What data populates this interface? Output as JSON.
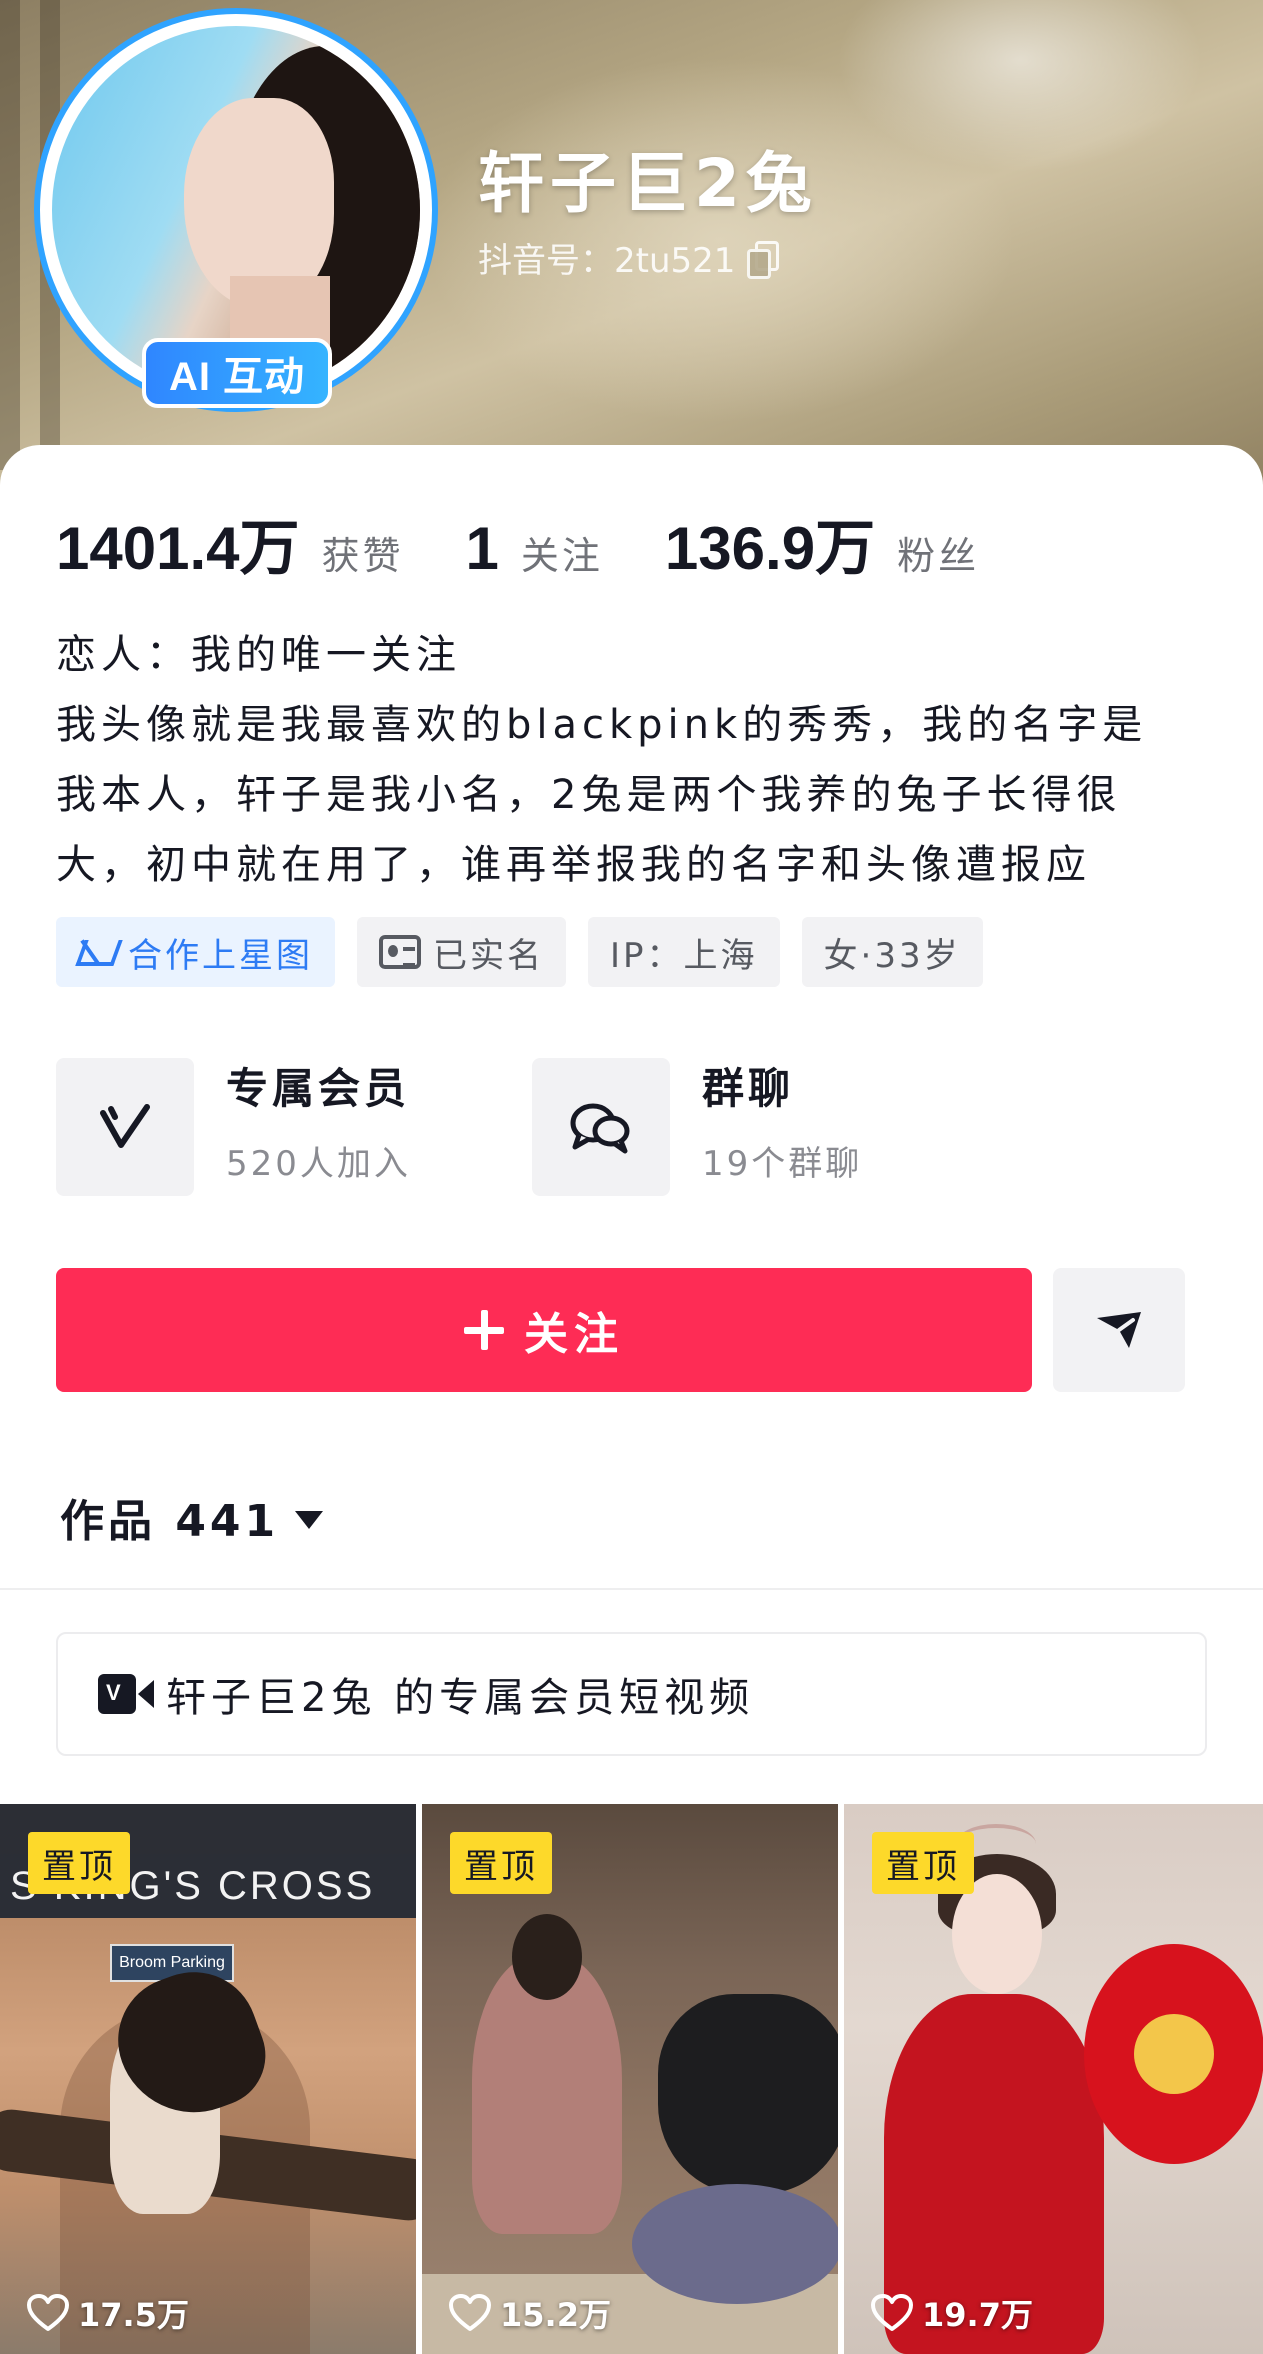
{
  "profile": {
    "name": "轩子巨2兔",
    "douyin_id": "抖音号：2tu521",
    "ai_badge": "AI 互动"
  },
  "stats": [
    {
      "value": "1401.4万",
      "label": "获赞"
    },
    {
      "value": "1",
      "label": "关注"
    },
    {
      "value": "136.9万",
      "label": "粉丝"
    }
  ],
  "bio": {
    "lines": [
      "恋人：我的唯一关注",
      "我头像就是我最喜欢的blackpink的秀秀，我的名字是",
      "我本人，轩子是我小名，2兔是两个我养的兔子长得很",
      "大，初中就在用了，谁再举报我的名字和头像遭报应"
    ]
  },
  "tags": {
    "star": "合作上星图",
    "verified": "已实名",
    "ip": "IP：上海",
    "gender_age": "女·33岁"
  },
  "features": {
    "member": {
      "title": "专属会员",
      "subtitle": "520人加入"
    },
    "group_chat": {
      "title": "群聊",
      "subtitle": "19个群聊"
    }
  },
  "actions": {
    "follow_label": "关注"
  },
  "works": {
    "label": "作品 441"
  },
  "member_bar": {
    "label": "轩子巨2兔 的专属会员短视频"
  },
  "videos": [
    {
      "pin_label": "置顶",
      "likes": "17.5万",
      "banner": "S KING'S CROSS",
      "sign": "Broom Parking"
    },
    {
      "pin_label": "置顶",
      "likes": "15.2万"
    },
    {
      "pin_label": "置顶",
      "likes": "19.7万"
    }
  ],
  "colors": {
    "accent": "#fe2c55",
    "avatar_ring": "#2fa3ff",
    "pin_yellow": "#fdd92a",
    "star_blue": "#2d7bf4"
  },
  "icons": [
    "copy-icon",
    "star-map-icon",
    "id-card-icon",
    "vip-v-icon",
    "chat-bubbles-icon",
    "plus-icon",
    "send-icon",
    "dropdown-triangle-icon",
    "member-video-icon",
    "heart-icon"
  ]
}
